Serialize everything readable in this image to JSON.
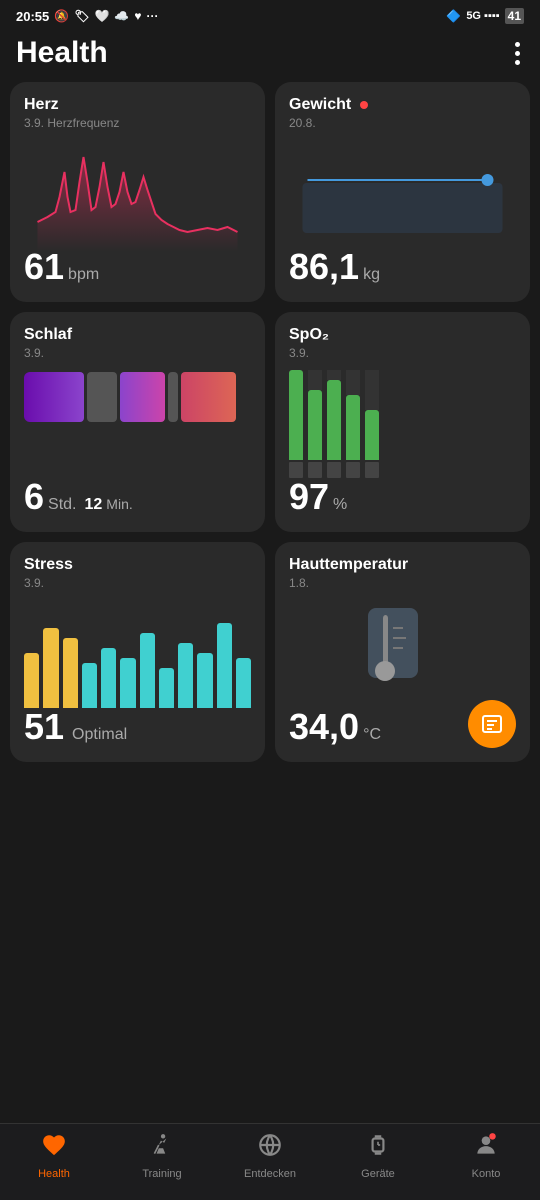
{
  "statusBar": {
    "time": "20:55",
    "battery": "41"
  },
  "header": {
    "title": "Health"
  },
  "cards": {
    "heart": {
      "title": "Herz",
      "subtitle": "3.9. Herzfrequenz",
      "value": "61",
      "unit": "bpm"
    },
    "weight": {
      "title": "Gewicht",
      "subtitle": "20.8.",
      "value": "86,1",
      "unit": "kg"
    },
    "sleep": {
      "title": "Schlaf",
      "subtitle": "3.9.",
      "valueMain": "6",
      "unitMain": "Std.",
      "valueSub": "12",
      "unitSub": "Min."
    },
    "spo2": {
      "title": "SpO₂",
      "subtitle": "3.9.",
      "value": "97",
      "unit": "%"
    },
    "stress": {
      "title": "Stress",
      "subtitle": "3.9.",
      "value": "51",
      "unit": "Optimal"
    },
    "temperature": {
      "title": "Hauttemperatur",
      "subtitle": "1.8.",
      "value": "34,0",
      "unit": "°C"
    }
  },
  "bottomNav": {
    "items": [
      {
        "id": "health",
        "label": "Health",
        "active": true
      },
      {
        "id": "training",
        "label": "Training",
        "active": false
      },
      {
        "id": "entdecken",
        "label": "Entdecken",
        "active": false
      },
      {
        "id": "gerate",
        "label": "Geräte",
        "active": false
      },
      {
        "id": "konto",
        "label": "Konto",
        "active": false
      }
    ]
  }
}
